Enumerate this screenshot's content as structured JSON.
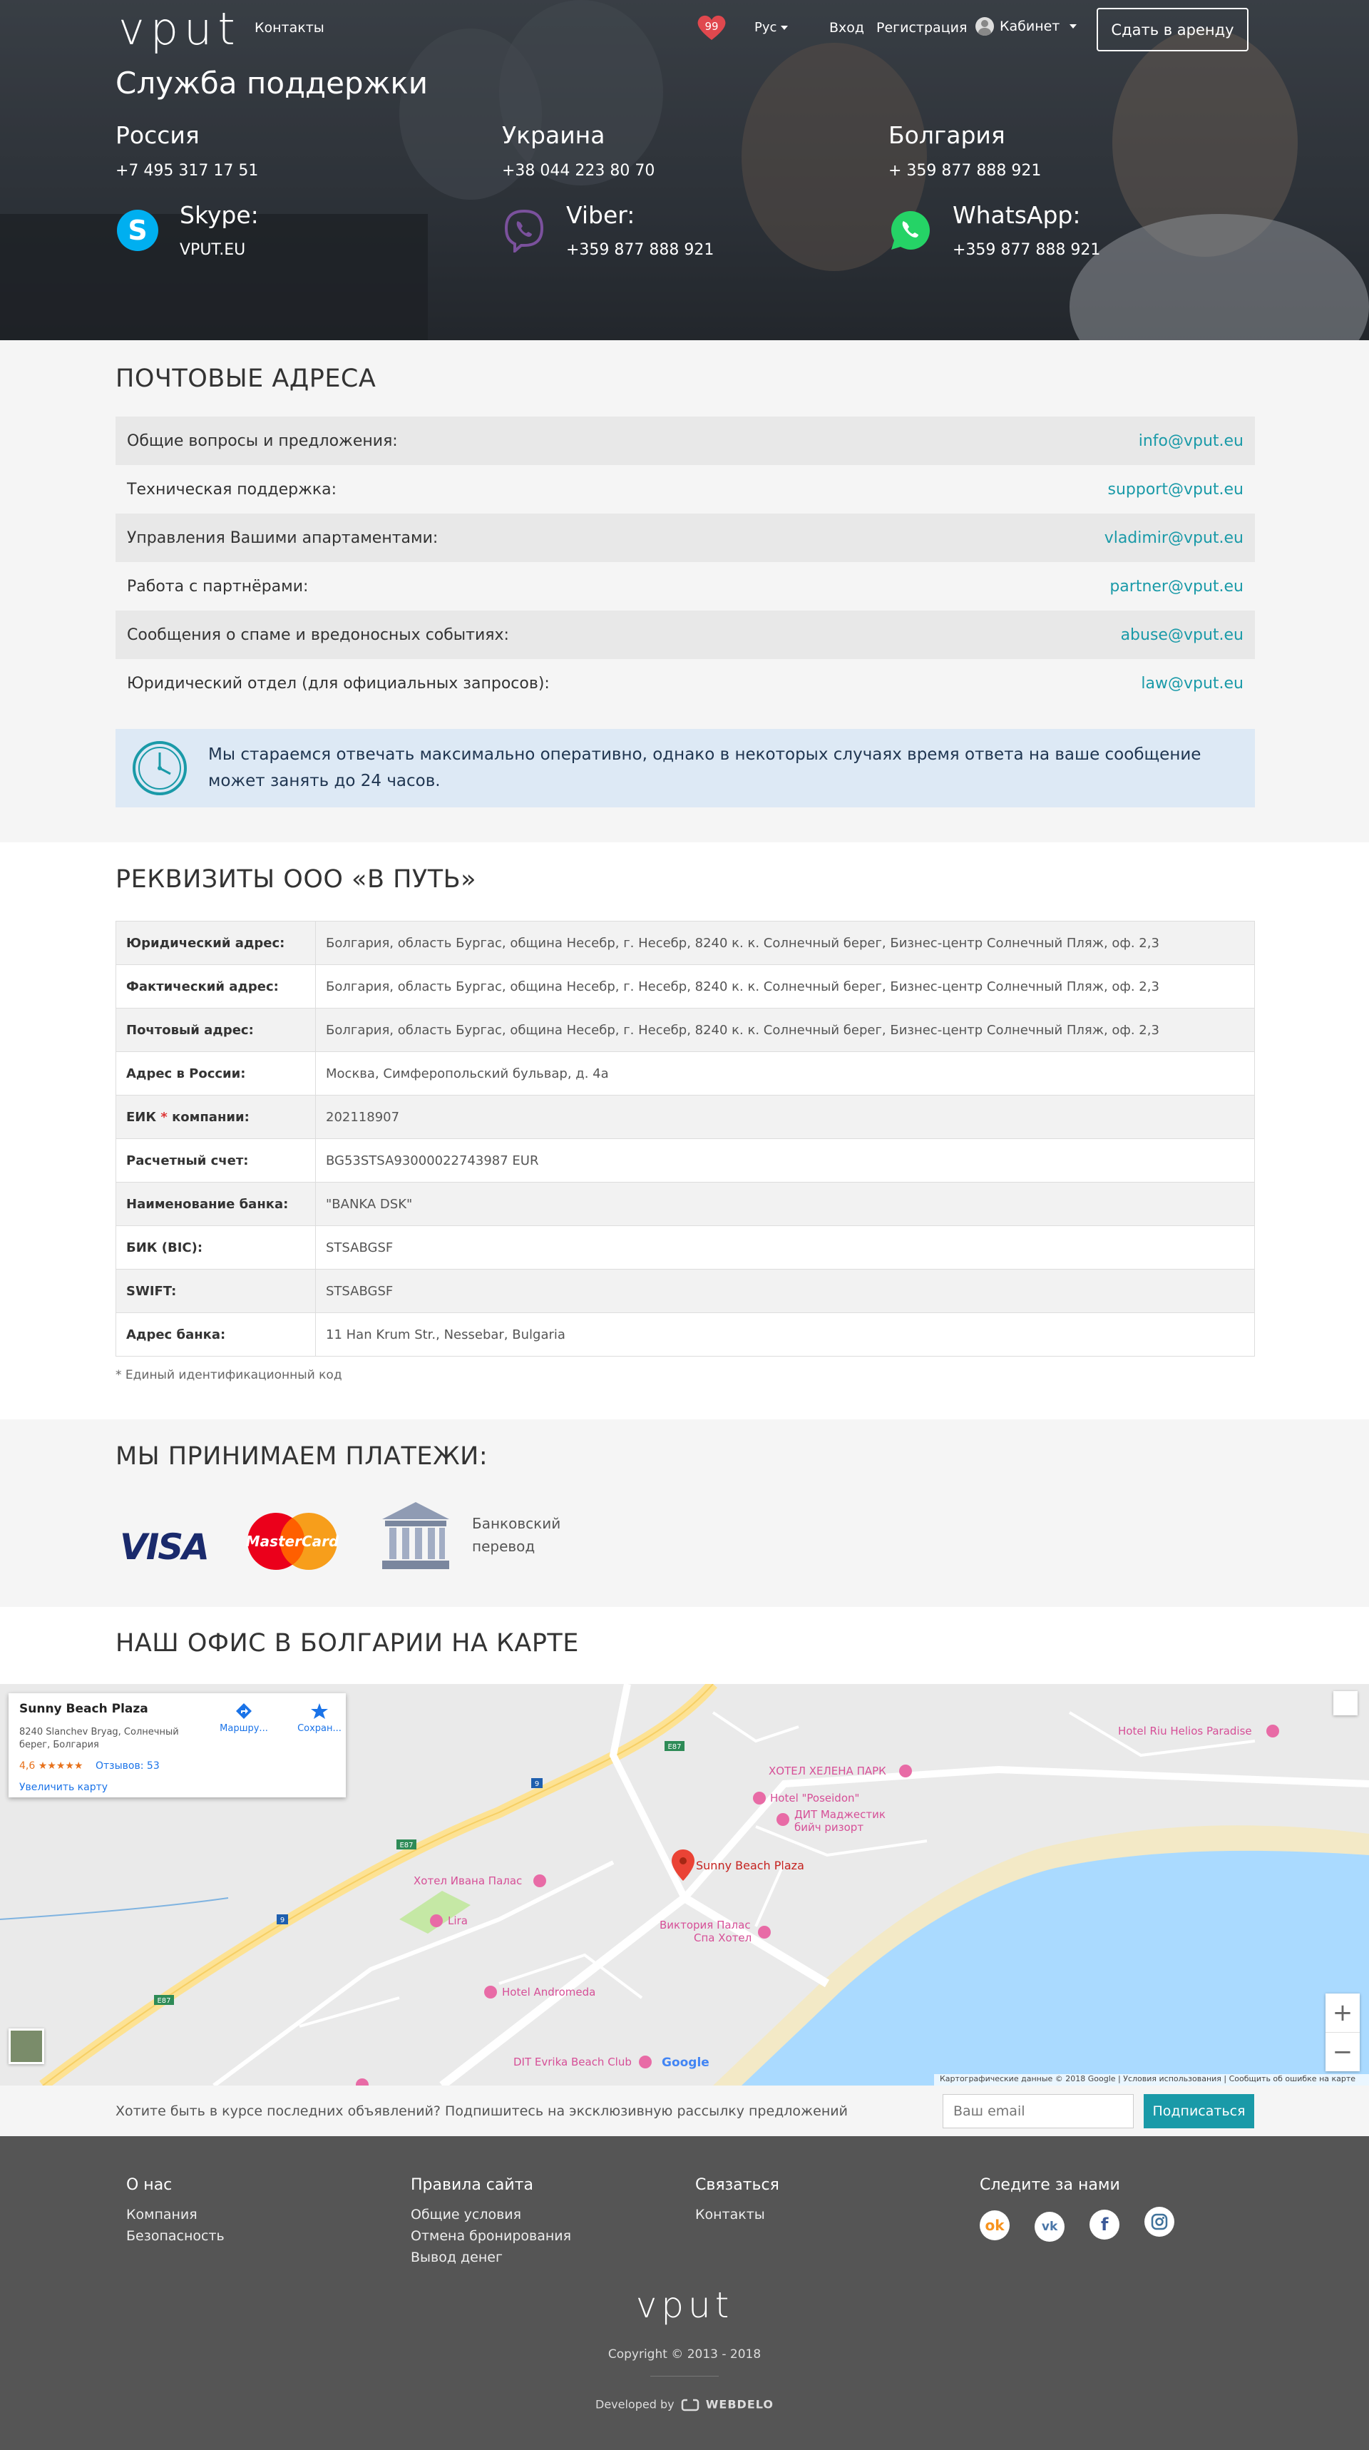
{
  "header": {
    "logo": "vput",
    "nav_contacts": "Контакты",
    "favorites_count": "99",
    "language": "Рус",
    "login": "Вход",
    "register": "Регистрация",
    "cabinet": "Кабинет",
    "rent_button": "Сдать в аренду"
  },
  "support": {
    "title": "Служба поддержки",
    "countries": [
      {
        "name": "Россия",
        "phone": "+7 495 317 17 51"
      },
      {
        "name": "Украина",
        "phone": "+38 044 223 80 70"
      },
      {
        "name": "Болгария",
        "phone": "+ 359 877 888 921"
      }
    ],
    "messengers": [
      {
        "name": "Skype:",
        "value": "VPUT.EU",
        "icon": "skype-icon",
        "color": "#00aff0"
      },
      {
        "name": "Viber:",
        "value": "+359 877 888 921",
        "icon": "viber-icon",
        "color": "#7b519d"
      },
      {
        "name": "WhatsApp:",
        "value": "+359 877 888 921",
        "icon": "whatsapp-icon",
        "color": "#25d366"
      }
    ]
  },
  "emails": {
    "title": "ПОЧТОВЫЕ АДРЕСА",
    "rows": [
      {
        "label": "Общие вопросы и предложения:",
        "email": "info@vput.eu"
      },
      {
        "label": "Техническая поддержка:",
        "email": "support@vput.eu"
      },
      {
        "label": "Управления Вашими апартаментами:",
        "email": "vladimir@vput.eu"
      },
      {
        "label": "Работа с партнёрами:",
        "email": "partner@vput.eu"
      },
      {
        "label": "Сообщения о спаме и вредоносных событиях:",
        "email": "abuse@vput.eu"
      },
      {
        "label": "Юридический отдел (для официальных запросов):",
        "email": "law@vput.eu"
      }
    ],
    "notice": "Мы стараемся отвечать максимально оперативно, однако в некоторых случаях время ответа на ваше сообщение может занять до 24 часов."
  },
  "requisites": {
    "title": "РЕКВИЗИТЫ ООО «В ПУТЬ»",
    "rows": [
      {
        "key": "Юридический адрес:",
        "value": "Болгария, область Бургас, община Несебр, г. Несебр, 8240 к. к. Солнечный берег, Бизнес-центр Солнечный Пляж, оф. 2,3"
      },
      {
        "key": "Фактический адрес:",
        "value": "Болгария, область Бургас, община Несебр, г. Несебр, 8240 к. к. Солнечный берег, Бизнес-центр Солнечный Пляж, оф. 2,3"
      },
      {
        "key": "Почтовый адрес:",
        "value": "Болгария, область Бургас, община Несебр, г. Несебр, 8240 к. к. Солнечный берег, Бизнес-центр Солнечный Пляж, оф. 2,3"
      },
      {
        "key": "Адрес в России:",
        "value": "Москва, Симферопольский бульвар, д. 4а"
      },
      {
        "key": "ЕИК",
        "value": "202118907"
      },
      {
        "key": "Расчетный счет:",
        "value": "BG53STSA93000022743987 EUR"
      },
      {
        "key": "Наименование банка:",
        "value": "\"BANKA DSK\""
      },
      {
        "key": "БИК (BIC):",
        "value": "STSABGSF"
      },
      {
        "key": "SWIFT:",
        "value": "STSABGSF"
      },
      {
        "key": "Адрес банка:",
        "value": "11 Han Krum Str., Nessebar, Bulgaria"
      }
    ],
    "eik_star": "*",
    "eik_suffix": "компании:",
    "footnote": "* Единый идентификационный код"
  },
  "payments": {
    "title": "МЫ ПРИНИМАЕМ ПЛАТЕЖИ:",
    "visa": "VISA",
    "mastercard": "MasterCard",
    "bank_line1": "Банковский",
    "bank_line2": "перевод"
  },
  "map": {
    "title": "НАШ ОФИС В БОЛГАРИИ НА КАРТЕ",
    "place_name": "Sunny Beach Plaza",
    "place_address": "8240 Slanchev Bryag, Солнечный берег, Болгария",
    "rating": "4,6 ★★★★★",
    "reviews": "Отзывов: 53",
    "enlarge": "Увеличить карту",
    "route": "Маршру...",
    "save": "Сохран...",
    "marker_label": "Sunny Beach Plaza",
    "zoom_in": "+",
    "zoom_out": "−",
    "pois": [
      "Hotel Riu Helios Paradise",
      "ХОТЕЛ ХЕЛЕНА ПАРК",
      "Hotel \"Poseidon\"",
      "ДИТ Маджестик",
      "бийч ризорт",
      "Хотел Ивана Палас",
      "Lira",
      "Виктория Палас",
      "Спа Хотел",
      "Hotel Andromeda",
      "DIT Evrika Beach Club",
      "Google"
    ],
    "roads": [
      "E87",
      "9",
      "E87",
      "9",
      "E87"
    ],
    "attribution": "Картографические данные © 2018 Google | Условия использования | Сообщить об ошибке на карте"
  },
  "subscribe": {
    "text": "Хотите быть в курсе последних объявлений? Подпишитесь на эксклюзивную рассылку предложений",
    "placeholder": "Ваш email",
    "button": "Подписаться"
  },
  "footer": {
    "col1": {
      "title": "О нас",
      "links": [
        "Компания",
        "Безопасность"
      ]
    },
    "col2": {
      "title": "Правила сайта",
      "links": [
        "Общие условия",
        "Отмена бронирования",
        "Вывод денег"
      ]
    },
    "col3": {
      "title": "Связаться",
      "links": [
        "Контакты"
      ]
    },
    "col4": {
      "title": "Следите за нами",
      "social": [
        "odnoklassniki-icon",
        "vk-icon",
        "facebook-icon",
        "instagram-icon"
      ]
    },
    "logo": "vput",
    "copyright": "Copyright © 2013 - 2018",
    "developed_by": "Developed by",
    "developer": "WEBDELO"
  },
  "colors": {
    "accent": "#1a9aa8",
    "notice_bg": "#dde9f5",
    "footer_bg": "#555555",
    "sea": "#aadaff"
  }
}
